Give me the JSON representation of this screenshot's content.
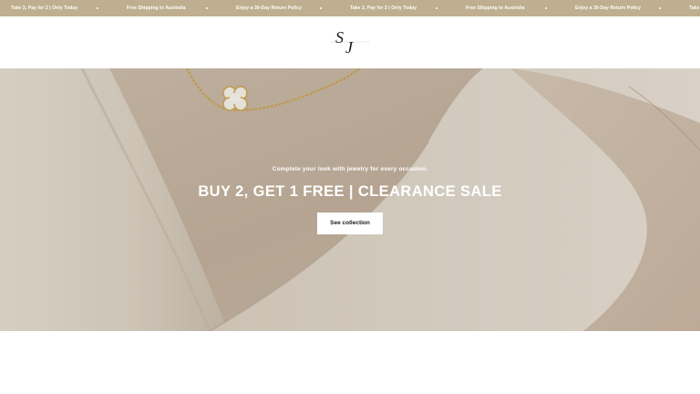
{
  "announcement_bar": {
    "background": "#bfae8f",
    "messages": [
      "Take 3, Pay for 2 | Only Today",
      "Free Shipping to Australia",
      "Enjoy a 30-Day Return Policy",
      "Take 3, Pay for 2 | Only Today",
      "Free Shipping to Australia",
      "Enjoy a 30-Day Return Policy",
      "Take"
    ]
  },
  "header": {
    "logo_monogram": "SJ"
  },
  "hero": {
    "subtitle": "Complete your look with jewelry for every occasion.",
    "title": "BUY 2, GET 1 FREE | CLEARANCE SALE",
    "button_label": "See collection"
  }
}
